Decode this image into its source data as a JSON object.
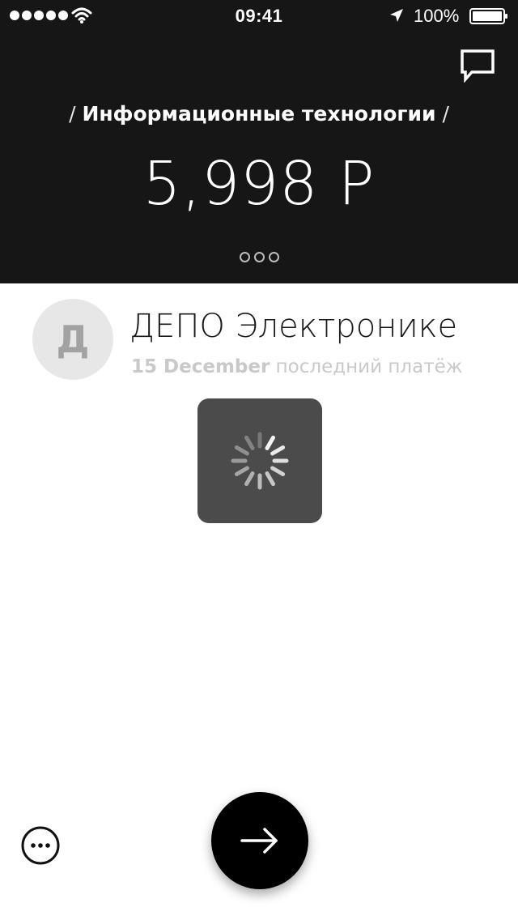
{
  "status_bar": {
    "time": "09:41",
    "battery": "100%",
    "signal_icon": "signal-dots-icon",
    "wifi_icon": "wifi-icon",
    "location_icon": "location-arrow-icon",
    "battery_icon": "battery-icon"
  },
  "header": {
    "category_prefix": "/",
    "category": "Информационные технологии",
    "category_suffix": "/",
    "amount": "5,998 Р",
    "chat_icon": "chat-bubble-icon",
    "page_count": 3,
    "background": "#161616"
  },
  "merchant": {
    "avatar_letter": "Д",
    "name": "ДЕПО Электронике",
    "last_payment_date": "15 December",
    "last_payment_label": "последний платёж"
  },
  "loading": {
    "icon": "spinner-icon"
  },
  "footer": {
    "more_icon": "more-dots-icon",
    "next_icon": "arrow-right-icon"
  }
}
